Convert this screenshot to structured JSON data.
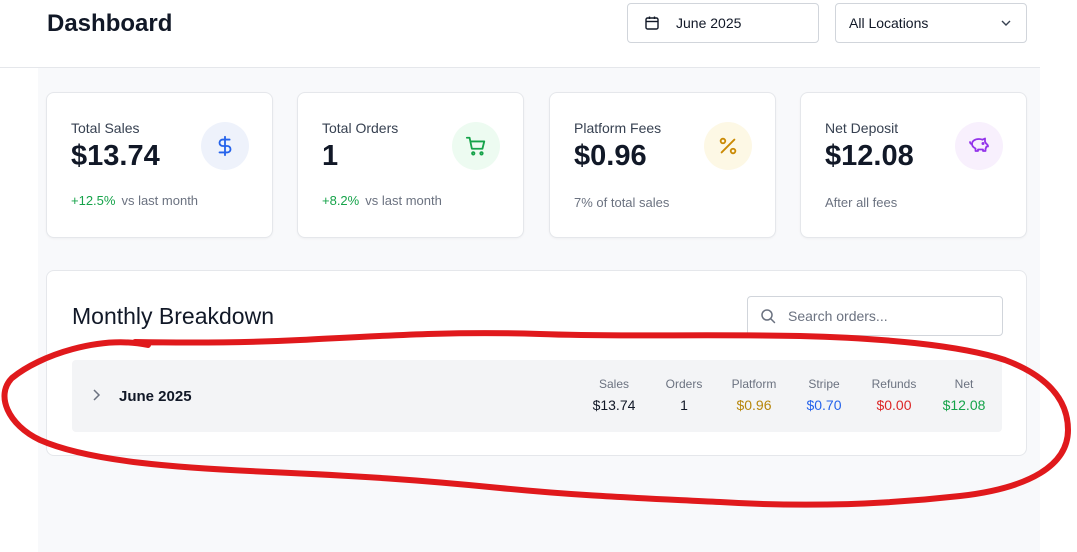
{
  "header": {
    "title": "Dashboard",
    "date_picker": {
      "value": "June 2025",
      "icon": "calendar-icon"
    },
    "location_select": {
      "value": "All Locations",
      "icon": "chevron-down-icon"
    }
  },
  "cards": [
    {
      "label": "Total Sales",
      "value": "$13.74",
      "change": "+12.5%",
      "sub": "vs last month",
      "icon": "dollar-icon",
      "icon_bg": "#eef2fb",
      "icon_color": "#2563eb"
    },
    {
      "label": "Total Orders",
      "value": "1",
      "change": "+8.2%",
      "sub": "vs last month",
      "icon": "cart-icon",
      "icon_bg": "#edfbf1",
      "icon_color": "#16a34a"
    },
    {
      "label": "Platform Fees",
      "value": "$0.96",
      "sub": "7% of total sales",
      "icon": "percent-icon",
      "icon_bg": "#fdf8e5",
      "icon_color": "#ca8a04"
    },
    {
      "label": "Net Deposit",
      "value": "$12.08",
      "sub": "After all fees",
      "icon": "piggy-bank-icon",
      "icon_bg": "#f8f0fd",
      "icon_color": "#9333ea"
    }
  ],
  "breakdown": {
    "title": "Monthly Breakdown",
    "search_placeholder": "Search orders...",
    "rows": [
      {
        "month": "June 2025",
        "stats": [
          {
            "label": "Sales",
            "value": "$13.74",
            "color": "#111827"
          },
          {
            "label": "Orders",
            "value": "1",
            "color": "#111827"
          },
          {
            "label": "Platform",
            "value": "$0.96",
            "color": "#b7860b"
          },
          {
            "label": "Stripe",
            "value": "$0.70",
            "color": "#2563eb"
          },
          {
            "label": "Refunds",
            "value": "$0.00",
            "color": "#dc2626"
          },
          {
            "label": "Net",
            "value": "$12.08",
            "color": "#16a34a"
          }
        ]
      }
    ]
  },
  "colors": {
    "annotation": "#e0191c",
    "positive": "#16a34a"
  }
}
